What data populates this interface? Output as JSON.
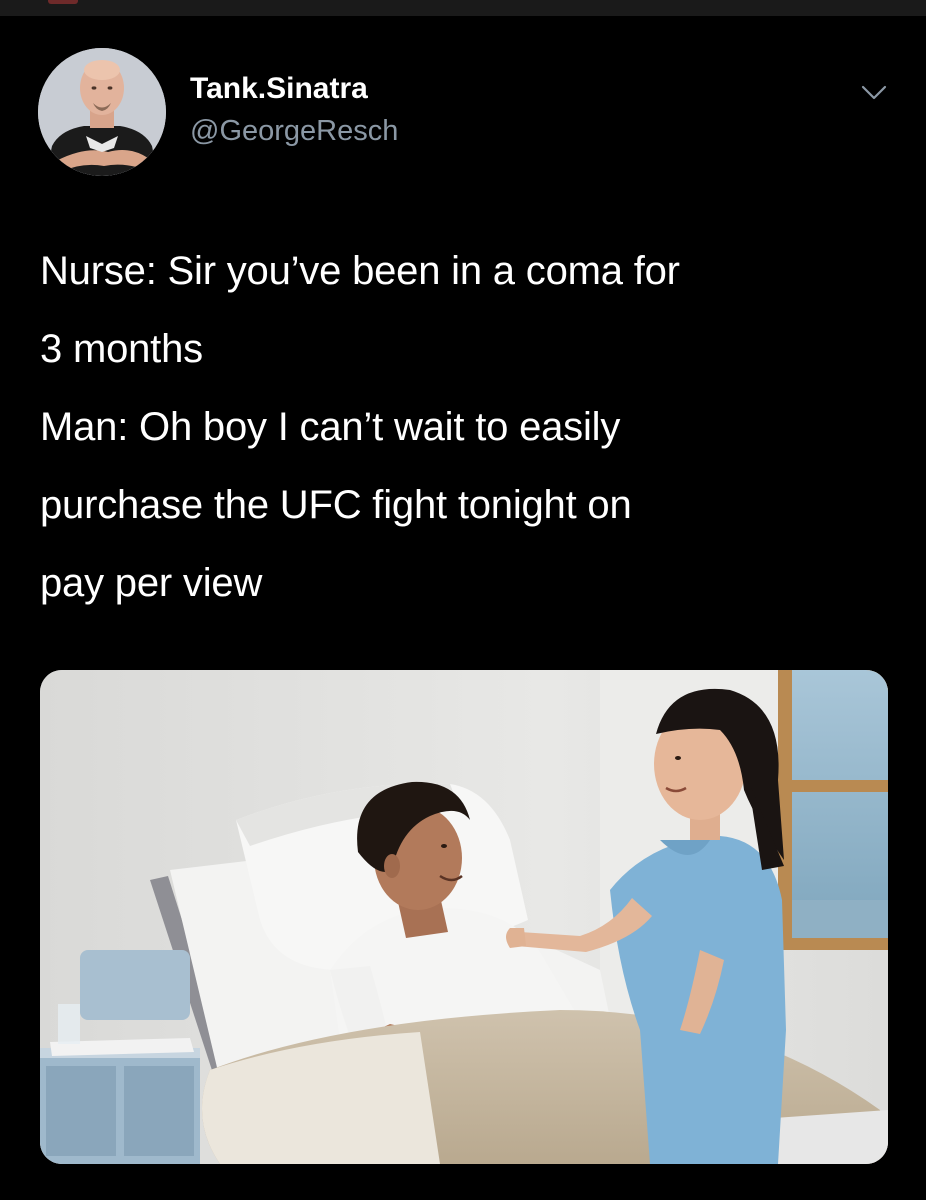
{
  "tweet": {
    "author": {
      "display_name": "Tank.Sinatra",
      "handle": "@GeorgeResch",
      "avatar_icon": "avatar-photo"
    },
    "menu_icon": "chevron-down-icon",
    "text_lines": [
      "Nurse: Sir you’ve been in a coma for",
      "3 months",
      "Man: Oh boy I can’t wait to easily",
      "purchase the UFC fight tonight on",
      "pay per view"
    ],
    "media": {
      "kind": "photo",
      "icon": "hospital-room-photo"
    }
  },
  "colors": {
    "background": "#000000",
    "text": "#ffffff",
    "secondary_text": "#8b98a5"
  }
}
